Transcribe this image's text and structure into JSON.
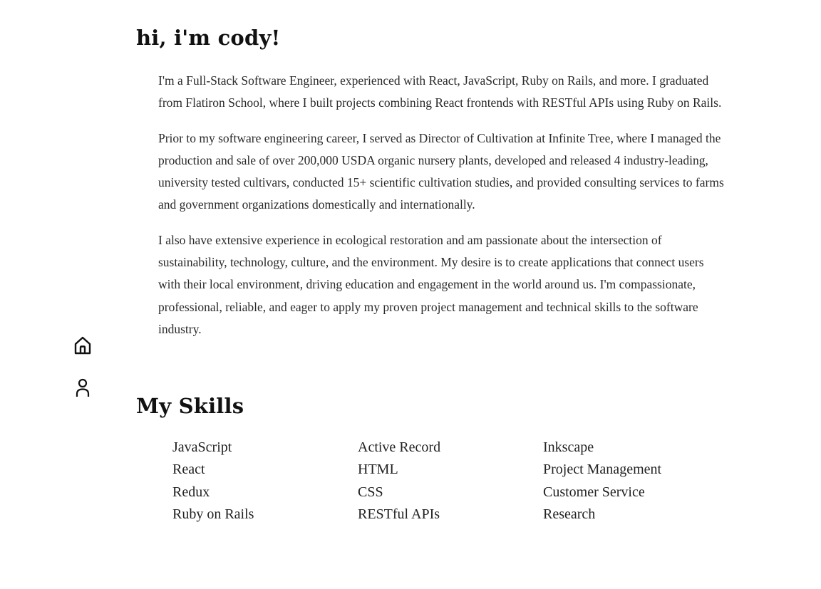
{
  "intro": {
    "heading": "hi, i'm cody!",
    "paragraphs": [
      "I'm a Full-Stack Software Engineer, experienced with React, JavaScript, Ruby on Rails, and more. I graduated from Flatiron School, where I built projects combining React frontends with RESTful APIs using Ruby on Rails.",
      "Prior to my software engineering career, I served as Director of Cultivation at Infinite Tree, where I managed the production and sale of over 200,000 USDA organic nursery plants, developed and released 4 industry-leading, university tested cultivars, conducted 15+ scientific cultivation studies, and provided consulting services to farms and government organizations domestically and internationally.",
      "I also have extensive experience in ecological restoration and am passionate about the intersection of sustainability, technology, culture, and the environment. My desire is to create applications that connect users with their local environment, driving education and engagement in the world around us. I'm compassionate, professional, reliable, and eager to apply my proven project management and technical skills to the software industry."
    ]
  },
  "nav": {
    "items": [
      {
        "icon": "home-icon"
      },
      {
        "icon": "user-icon"
      }
    ]
  },
  "skills": {
    "heading": "My Skills",
    "columns": [
      [
        "JavaScript",
        "React",
        "Redux",
        "Ruby on Rails"
      ],
      [
        "Active Record",
        "HTML",
        "CSS",
        "RESTful APIs"
      ],
      [
        "Inkscape",
        "Project Management",
        "Customer Service",
        "Research"
      ]
    ]
  }
}
